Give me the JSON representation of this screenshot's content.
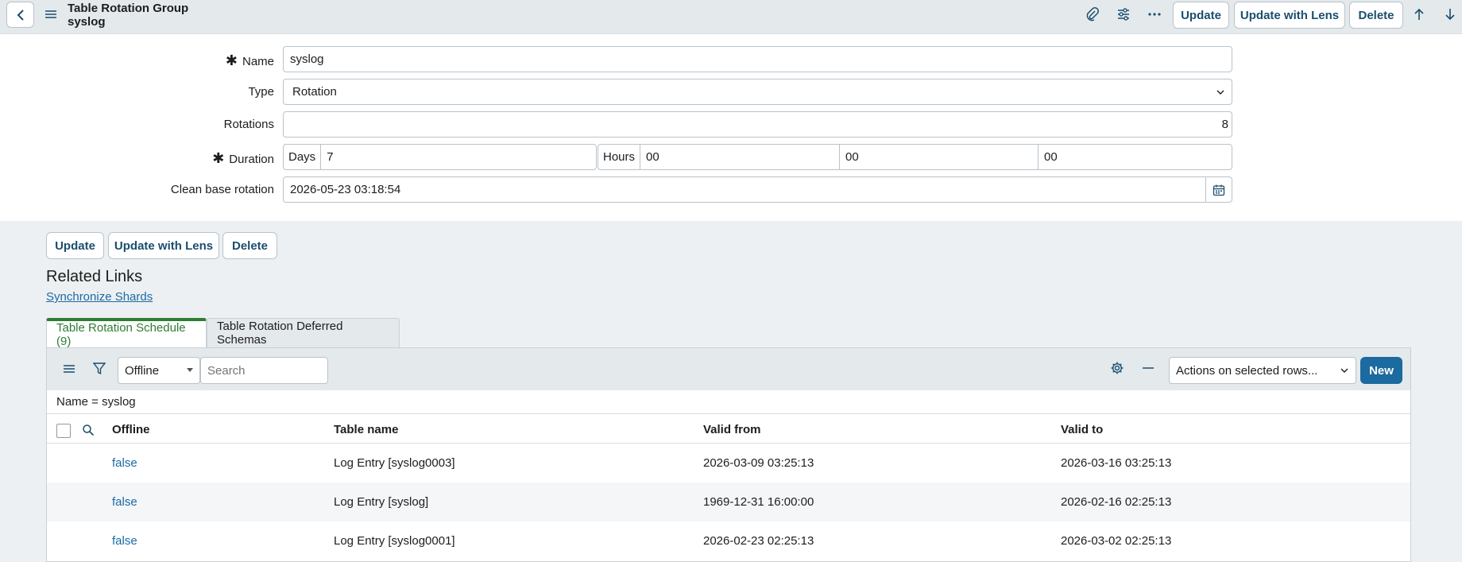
{
  "header": {
    "title_line1": "Table Rotation Group",
    "title_line2": "syslog",
    "update_label": "Update",
    "update_with_lens_label": "Update with Lens",
    "delete_label": "Delete"
  },
  "form": {
    "name_label": "Name",
    "name_value": "syslog",
    "type_label": "Type",
    "type_value": "Rotation",
    "rotations_label": "Rotations",
    "rotations_value": "8",
    "duration_label": "Duration",
    "days_label": "Days",
    "days_value": "7",
    "hours_label": "Hours",
    "hours_value": "00",
    "minutes_value": "00",
    "seconds_value": "00",
    "clean_base_label": "Clean base rotation",
    "clean_base_value": "2026-05-23 03:18:54"
  },
  "bottom_buttons": {
    "update_label": "Update",
    "update_with_lens_label": "Update with Lens",
    "delete_label": "Delete"
  },
  "related": {
    "title": "Related Links",
    "link": "Synchronize Shards"
  },
  "tabs": [
    {
      "label": "Table Rotation Schedule (9)"
    },
    {
      "label": "Table Rotation Deferred Schemas"
    }
  ],
  "list": {
    "search_field_value": "Offline",
    "search_placeholder": "Search",
    "actions_value": "Actions on selected rows...",
    "new_label": "New",
    "filter_text": "Name = syslog",
    "columns": [
      "Offline",
      "Table name",
      "Valid from",
      "Valid to"
    ],
    "rows": [
      {
        "offline": "false",
        "table": "Log Entry [syslog0003]",
        "from": "2026-03-09 03:25:13",
        "to": "2026-03-16 03:25:13"
      },
      {
        "offline": "false",
        "table": "Log Entry [syslog]",
        "from": "1969-12-31 16:00:00",
        "to": "2026-02-16 02:25:13"
      },
      {
        "offline": "false",
        "table": "Log Entry [syslog0001]",
        "from": "2026-02-23 02:25:13",
        "to": "2026-03-02 02:25:13"
      }
    ]
  },
  "colors": {
    "accent": "#1a4e6e",
    "active_tab": "#2e7d32",
    "link": "#1a6aa5",
    "primary_button": "#1b6aa0"
  }
}
